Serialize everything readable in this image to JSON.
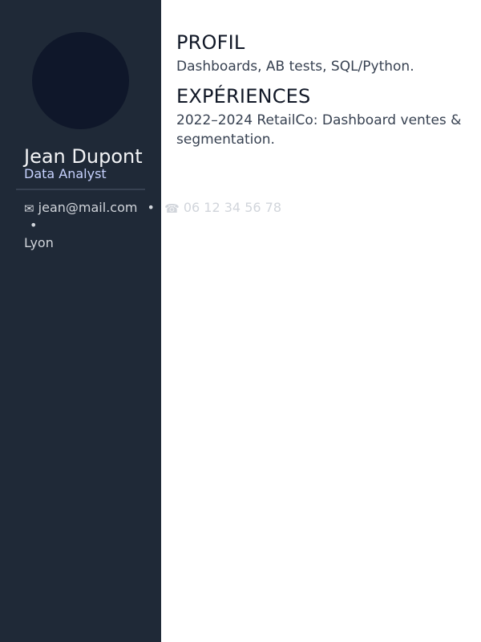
{
  "sidebar": {
    "name": "Jean Dupont",
    "role": "Data Analyst",
    "contact": {
      "email_icon": "email-icon",
      "email_icon_glyph": "✉",
      "email": "jean@mail.com",
      "separator": "•",
      "phone_icon": "phone-icon",
      "phone_icon_glyph": "☎",
      "phone": "06 12 34 56 78",
      "location": "Lyon"
    }
  },
  "main": {
    "profile": {
      "title": "PROFIL",
      "text": "Dashboards, AB tests, SQL/Python."
    },
    "experience": {
      "title": "EXPÉRIENCES",
      "text": "2022–2024 RetailCo: Dashboard ventes & segmentation."
    }
  },
  "colors": {
    "sidebar_background": "#1f2937",
    "avatar_background": "#0f172a",
    "name": "#f3f4f6",
    "role": "#c7d2fe",
    "main_text": "#111827",
    "section_text": "#374151"
  }
}
